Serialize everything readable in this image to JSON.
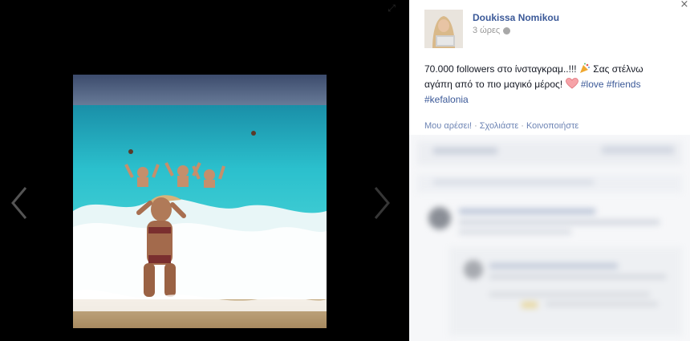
{
  "post": {
    "author": "Doukissa Nomikou",
    "time": "3 ώρες",
    "text_part1": "70.000 followers στο ίνσταγκραμ..!!! ",
    "text_part2": " Σας στέλνω αγάπη από το πιο μαγικό μέρος! ",
    "hashtag_love": "#love",
    "hashtag_friends": "#friends",
    "hashtag_kefalonia": "#kefalonia"
  },
  "actions": {
    "like": "Μου αρέσει!",
    "comment": "Σχολιάστε",
    "share": "Κοινοποιήστε",
    "separator": "·"
  },
  "icons": {
    "expand": "expand-icon",
    "close": "close-icon",
    "prev": "chevron-left-icon",
    "next": "chevron-right-icon",
    "globe": "globe-icon",
    "heart": "heart-icon",
    "party": "party-popper-icon"
  },
  "colors": {
    "link": "#3b5998",
    "viewer_bg": "#000000",
    "panel_bg": "#ffffff"
  }
}
